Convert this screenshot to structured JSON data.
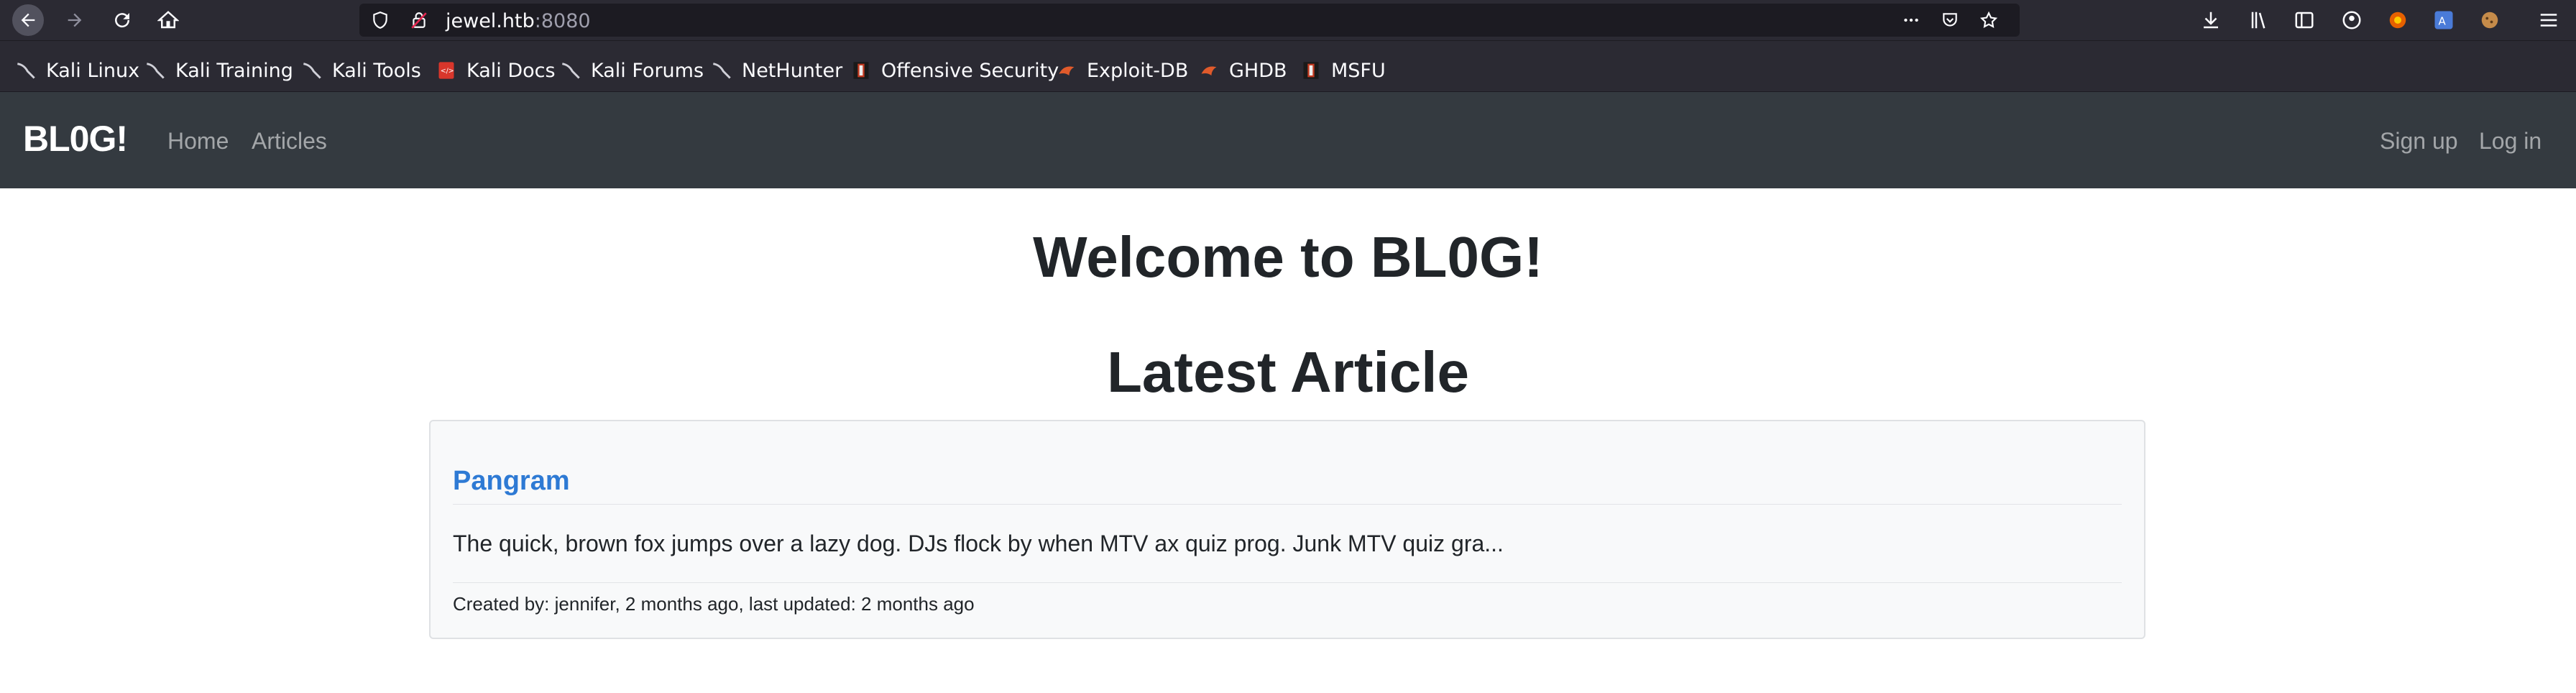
{
  "browser": {
    "url_host": "jewel.htb",
    "url_port": ":8080",
    "bookmarks": [
      {
        "label": "Kali Linux",
        "icon": "kali-dragon-icon"
      },
      {
        "label": "Kali Training",
        "icon": "kali-dragon-icon"
      },
      {
        "label": "Kali Tools",
        "icon": "kali-dragon-icon"
      },
      {
        "label": "Kali Docs",
        "icon": "kali-docs-icon"
      },
      {
        "label": "Kali Forums",
        "icon": "kali-dragon-icon"
      },
      {
        "label": "NetHunter",
        "icon": "kali-dragon-icon"
      },
      {
        "label": "Offensive Security",
        "icon": "offsec-icon"
      },
      {
        "label": "Exploit-DB",
        "icon": "exploitdb-icon"
      },
      {
        "label": "GHDB",
        "icon": "exploitdb-icon"
      },
      {
        "label": "MSFU",
        "icon": "offsec-icon"
      }
    ]
  },
  "site": {
    "brand": "BL0G!",
    "nav": {
      "home": "Home",
      "articles": "Articles",
      "signup": "Sign up",
      "login": "Log in"
    },
    "welcome": "Welcome to BL0G!",
    "latest_heading": "Latest Article",
    "article": {
      "title": "Pangram",
      "excerpt": "The quick, brown fox jumps over a lazy dog. DJs flock by when MTV ax quiz prog. Junk MTV quiz gra...",
      "meta": "Created by: jennifer, 2 months ago, last updated: 2 months ago"
    }
  },
  "colors": {
    "chrome": "#2b2a33",
    "navbar": "#343a40",
    "link": "#2e7ad4"
  }
}
